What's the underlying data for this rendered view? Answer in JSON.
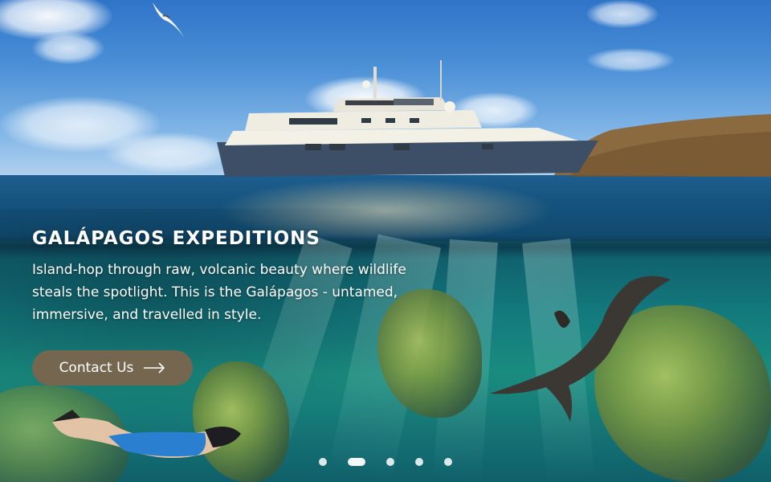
{
  "hero": {
    "title": "GALÁPAGOS EXPEDITIONS",
    "description": "Island-hop through raw, volcanic beauty where wildlife steals the spotlight. This is the Galápagos - untamed, immersive, and travelled in style.",
    "cta_label": "Contact Us",
    "cta_icon": "arrow-right-icon",
    "background_image": "yacht-and-sea-lion-split-view"
  },
  "carousel": {
    "slide_count": 5,
    "active_index": 1
  },
  "colors": {
    "cta_background": "#75664f",
    "text": "#ffffff"
  }
}
